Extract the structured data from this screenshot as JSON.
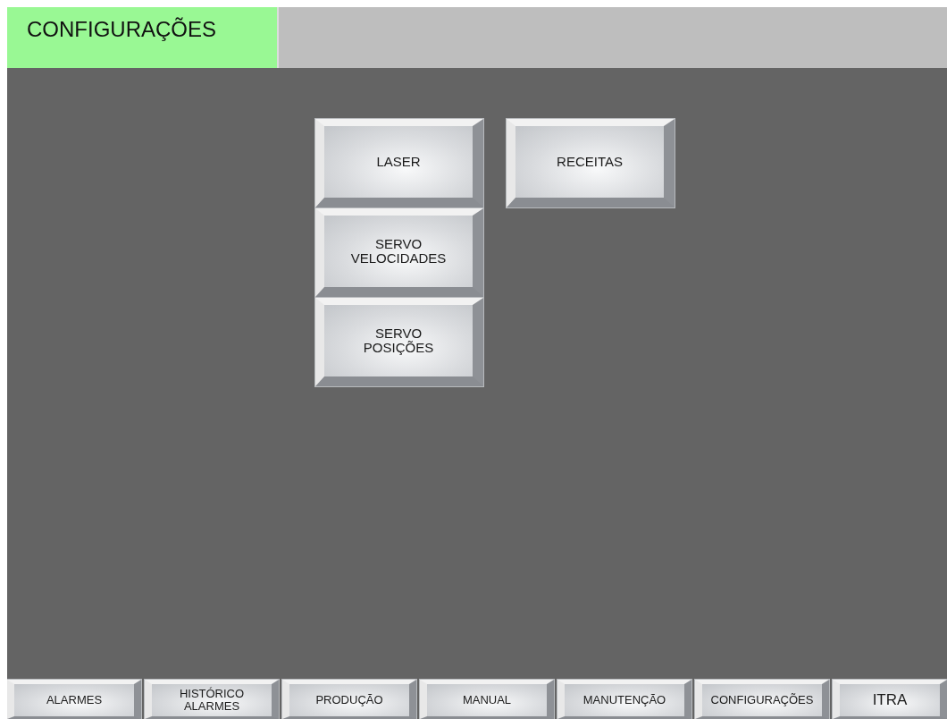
{
  "header": {
    "title": "CONFIGURAÇÕES"
  },
  "menu_columns": [
    [
      {
        "label": "LASER"
      },
      {
        "label": "SERVO\nVELOCIDADES"
      },
      {
        "label": "SERVO\nPOSIÇÕES"
      }
    ],
    [
      {
        "label": "RECEITAS"
      }
    ]
  ],
  "nav_bar": [
    {
      "label": "ALARMES",
      "kind": "nav"
    },
    {
      "label": "HISTÓRICO\nALARMES",
      "kind": "nav"
    },
    {
      "label": "PRODUÇÃO",
      "kind": "nav"
    },
    {
      "label": "MANUAL",
      "kind": "nav"
    },
    {
      "label": "MANUTENÇÃO",
      "kind": "nav"
    },
    {
      "label": "CONFIGURAÇÕES",
      "kind": "nav"
    },
    {
      "label": "ITRA",
      "kind": "brand"
    }
  ]
}
